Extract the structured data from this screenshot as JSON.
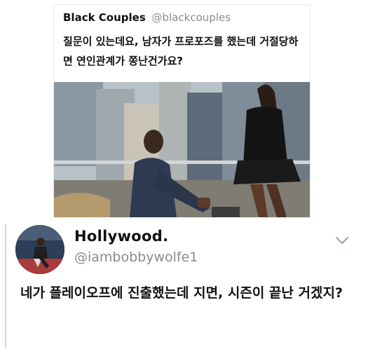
{
  "quoted_tweet": {
    "name": "Black Couples",
    "handle": "@blackcouples",
    "text": "질문이 있는데요, 남자가 프로포즈를 했는데 거절당하면 연인관계가 쫑난건가요?",
    "image_icon": "photo-of-man-proposing-on-rooftop"
  },
  "reply_tweet": {
    "avatar_icon": "avatar-basketball-player",
    "display_name": "Hollywood.",
    "handle": "@iambobbywolfe1",
    "menu_icon": "chevron-down-icon",
    "text": "네가 플레이오프에 진출했는데 지면, 시즌이 끝난 거겠지?"
  },
  "colors": {
    "text": "#111111",
    "muted": "#8a8a8a",
    "border": "#e6ecf0"
  }
}
